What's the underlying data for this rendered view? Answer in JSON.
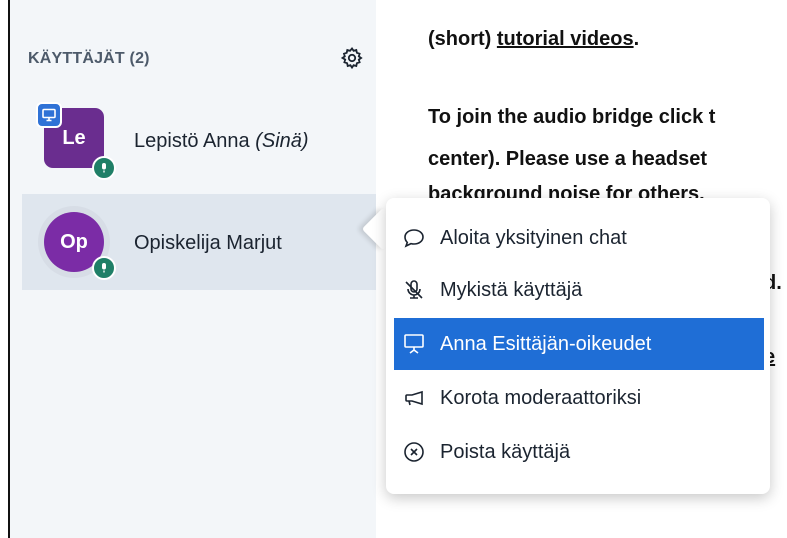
{
  "sidebar": {
    "title": "KÄYTTÄJÄT (2)",
    "users": [
      {
        "initials": "Le",
        "name": "Lepistö Anna",
        "self_suffix": "(Sinä)",
        "avatar_color": "#6a2d8f"
      },
      {
        "initials": "Op",
        "name": "Opiskelija Marjut",
        "avatar_color": "#7b2ca6"
      }
    ]
  },
  "content": {
    "line1_prefix": "(short) ",
    "line1_link": "tutorial videos",
    "line1_suffix": ".",
    "line2": "To join the audio bridge click t",
    "line3": "center). Please use a headset",
    "line4": "background noise for others.",
    "line5": "d.",
    "line6": "e"
  },
  "context_menu": {
    "items": [
      {
        "label": "Aloita yksityinen chat",
        "icon": "chat-bubble-icon"
      },
      {
        "label": "Mykistä käyttäjä",
        "icon": "mic-muted-icon"
      },
      {
        "label": "Anna Esittäjän-oikeudet",
        "icon": "presentation-icon"
      },
      {
        "label": "Korota moderaattoriksi",
        "icon": "megaphone-icon"
      },
      {
        "label": "Poista käyttäjä",
        "icon": "remove-circle-icon"
      }
    ],
    "highlight_color": "#1f6ed6"
  }
}
